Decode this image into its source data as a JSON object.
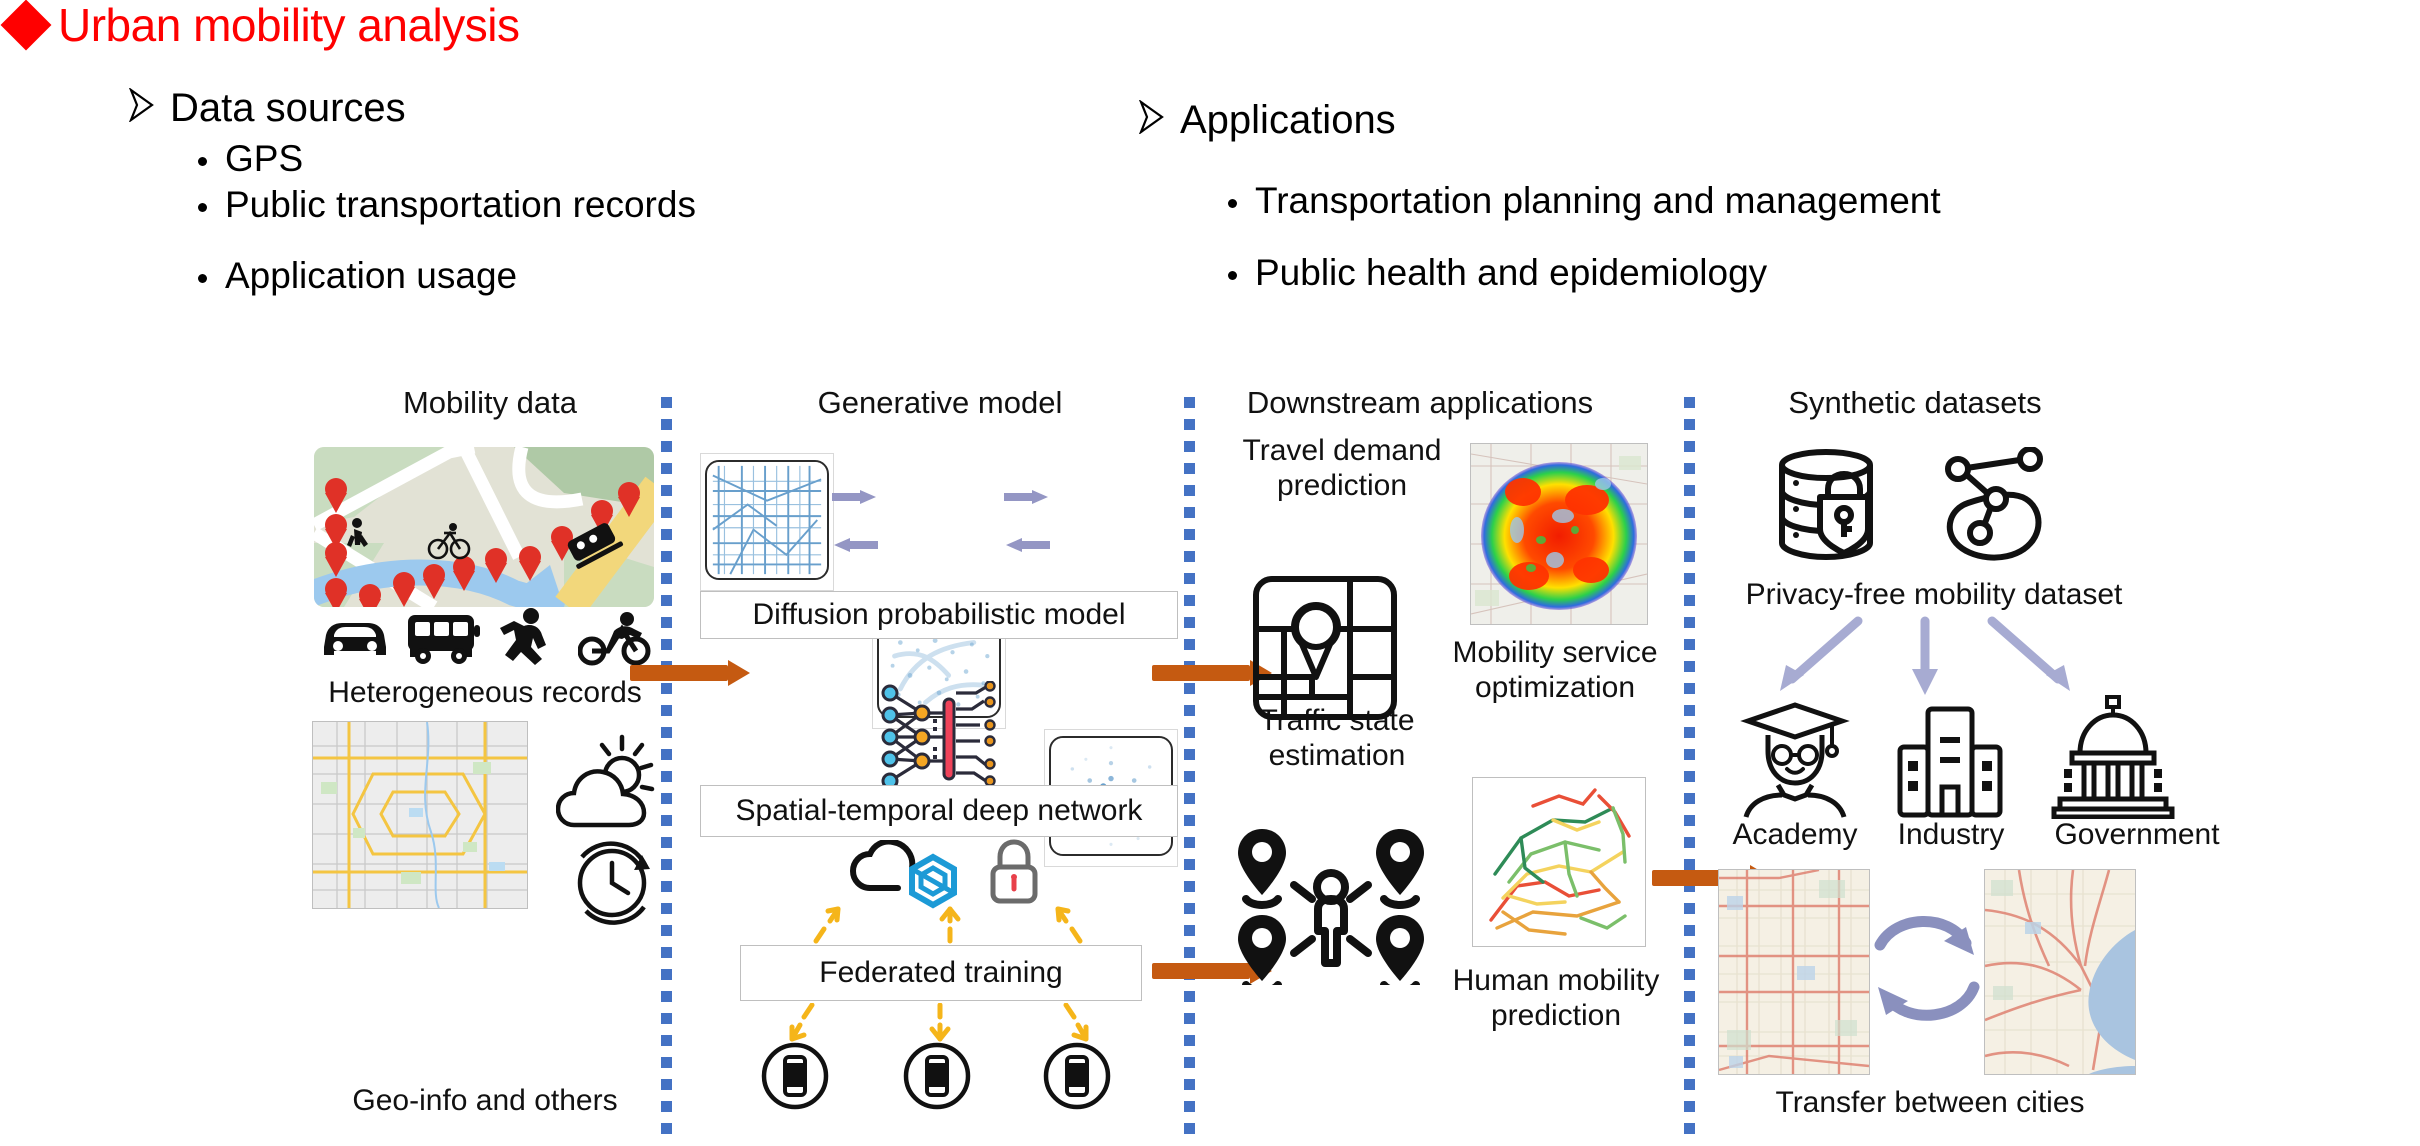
{
  "slide": {
    "title": "Urban mobility analysis",
    "bullet_marker": "diamond",
    "title_color": "#FF0000",
    "left_block": {
      "heading": "Data sources",
      "items": [
        "GPS",
        "Public transportation records",
        "Application usage"
      ]
    },
    "right_block": {
      "heading": "Applications",
      "items": [
        "Transportation planning and management",
        "Public health and epidemiology"
      ]
    }
  },
  "figure": {
    "separator_color": "#4472C4",
    "flow_arrow_color": "#C55A11",
    "columns": [
      {
        "header": "Mobility data"
      },
      {
        "header": "Generative model"
      },
      {
        "header": "Downstream applications"
      },
      {
        "header": "Synthetic datasets"
      }
    ],
    "mobility_data": {
      "map_caption": "Heterogeneous records",
      "mode_icons": [
        "car-icon",
        "bus-icon",
        "pedestrian-icon",
        "cyclist-icon"
      ],
      "map_markers": "red-pin-icon",
      "geo_caption": "Geo-info and others",
      "side_icons": [
        "weather-sun-cloud-icon",
        "clock-icon"
      ]
    },
    "generative_model": {
      "diffusion_label": "Diffusion probabilistic model",
      "diffusion_stages": [
        "city-road-network",
        "partially-noised",
        "gaussian-noise"
      ],
      "network_label": "Spatial-temporal deep network",
      "network_icon": "neural-network-icon",
      "federated_label": "Federated training",
      "federated_icons": [
        "cloud-icon",
        "hexagon-icon",
        "padlock-icon"
      ],
      "client_icons": [
        "smartphone-icon",
        "smartphone-icon",
        "smartphone-icon"
      ]
    },
    "downstream": {
      "items": [
        {
          "label": "Travel demand prediction",
          "icon": "map-pin-grid-icon"
        },
        {
          "label": "Mobility service optimization",
          "icon": "heatmap-thumbnail"
        },
        {
          "label": "Traffic state estimation",
          "icon": "person-pins-icon"
        },
        {
          "label": "Human mobility prediction",
          "icon": "traffic-network-thumbnail"
        }
      ]
    },
    "synthetic": {
      "dataset_caption": "Privacy-free mobility dataset",
      "dataset_icons": [
        "secure-database-icon",
        "graph-network-icon"
      ],
      "stakeholders": [
        {
          "label": "Academy",
          "icon": "graduate-icon"
        },
        {
          "label": "Industry",
          "icon": "office-building-icon"
        },
        {
          "label": "Government",
          "icon": "capitol-building-icon"
        }
      ],
      "transfer_caption": "Transfer between cities",
      "transfer_icon": "bidirectional-arrow-icon"
    }
  }
}
